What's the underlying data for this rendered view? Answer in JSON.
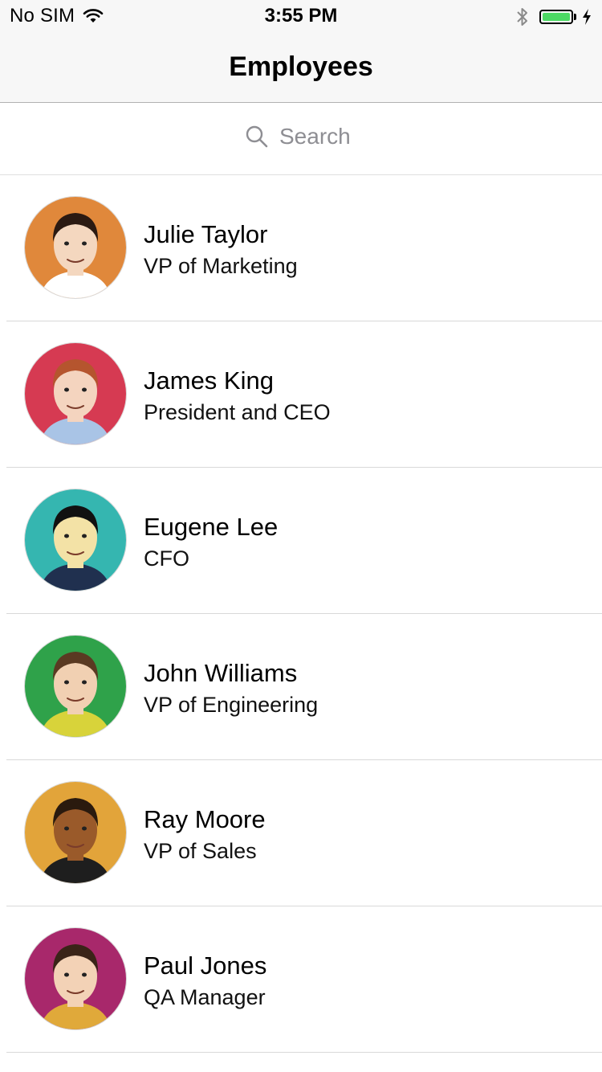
{
  "status_bar": {
    "carrier": "No SIM",
    "time": "3:55 PM",
    "battery_level": 1.0,
    "icons": [
      "wifi-icon",
      "bluetooth-icon",
      "battery-icon",
      "charging-bolt-icon"
    ]
  },
  "nav": {
    "title": "Employees"
  },
  "search": {
    "placeholder": "Search",
    "value": "",
    "icon": "search-icon"
  },
  "colors": {
    "bar_background": "#f7f7f7",
    "battery_green": "#4cd964",
    "placeholder_gray": "#8e8e93",
    "separator": "#d9d9d9"
  },
  "employees": [
    {
      "name": "Julie Taylor",
      "title": "VP of Marketing",
      "avatar_bg": "#e0883b",
      "hair": "#2b1a12",
      "skin": "#f4d7bf",
      "shirt": "#ffffff"
    },
    {
      "name": "James King",
      "title": "President and CEO",
      "avatar_bg": "#d63a52",
      "hair": "#b5552e",
      "skin": "#f4d4bf",
      "shirt": "#a9c4e6"
    },
    {
      "name": "Eugene Lee",
      "title": "CFO",
      "avatar_bg": "#35b6b0",
      "hair": "#111111",
      "skin": "#f3e2a6",
      "shirt": "#20304f"
    },
    {
      "name": "John Williams",
      "title": "VP of Engineering",
      "avatar_bg": "#2fa24a",
      "hair": "#5a3a22",
      "skin": "#f1d0b2",
      "shirt": "#d8d33a"
    },
    {
      "name": "Ray Moore",
      "title": "VP of Sales",
      "avatar_bg": "#e2a43a",
      "hair": "#2a1a0e",
      "skin": "#9a5a2a",
      "shirt": "#1e1e1e"
    },
    {
      "name": "Paul Jones",
      "title": "QA Manager",
      "avatar_bg": "#a8286b",
      "hair": "#3a2418",
      "skin": "#f3d2b6",
      "shirt": "#e0a93a"
    }
  ]
}
